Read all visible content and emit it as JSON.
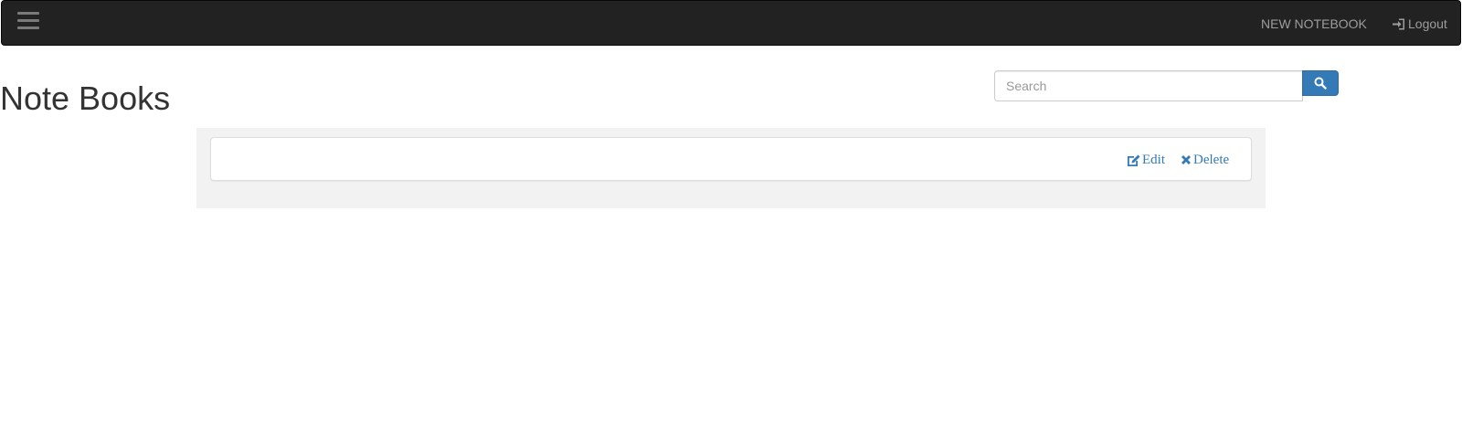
{
  "navbar": {
    "menu_icon": "hamburger-icon",
    "new_notebook_label": "NEW NOTEBOOK",
    "logout_label": "Logout",
    "logout_icon": "log-in-icon"
  },
  "page": {
    "title": "Note Books"
  },
  "search": {
    "placeholder": "Search",
    "value": "",
    "button_icon": "search-icon"
  },
  "notebooks": [
    {
      "name": "",
      "edit_label": "Edit",
      "edit_icon": "edit-icon",
      "delete_label": "Delete",
      "delete_icon": "remove-icon"
    }
  ],
  "colors": {
    "navbar_bg": "#222222",
    "nav_text": "#9d9d9d",
    "primary": "#337ab7",
    "well_bg": "#f2f2f2"
  }
}
